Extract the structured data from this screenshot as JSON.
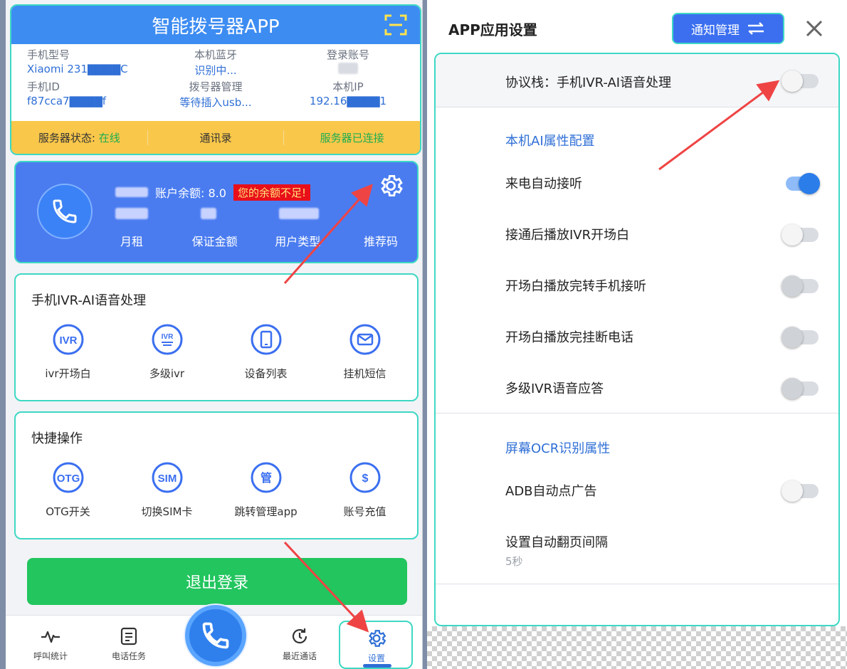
{
  "header": {
    "title": "智能拨号器APP",
    "info": [
      {
        "label": "手机型号",
        "value": "Xiaomi 231▇▇▇▇C"
      },
      {
        "label": "本机蓝牙",
        "value": "识别中..."
      },
      {
        "label": "登录账号",
        "value": ""
      },
      {
        "label": "手机ID",
        "value": "f87cca7▇▇▇▇f"
      },
      {
        "label": "拨号器管理",
        "value": "等待插入usb..."
      },
      {
        "label": "本机IP",
        "value": "192.16▇▇▇▇1"
      }
    ],
    "status": {
      "server_label": "服务器状态:",
      "server_value": "在线",
      "contacts": "通讯录",
      "connected": "服务器已连接"
    }
  },
  "account": {
    "balance": "账户余额: 8.0",
    "warning": "您的余额不足!",
    "labels": [
      "月租",
      "保证金额",
      "用户类型",
      "推荐码"
    ]
  },
  "ivr_card": {
    "title": "手机IVR-AI语音处理",
    "items": [
      {
        "label": "ivr开场白",
        "icon": "ivr-icon"
      },
      {
        "label": "多级ivr",
        "icon": "multi-ivr-icon"
      },
      {
        "label": "设备列表",
        "icon": "device-list-icon"
      },
      {
        "label": "挂机短信",
        "icon": "sms-icon"
      }
    ]
  },
  "quick_card": {
    "title": "快捷操作",
    "items": [
      {
        "label": "OTG开关",
        "icon": "otg-icon"
      },
      {
        "label": "切换SIM卡",
        "icon": "sim-icon"
      },
      {
        "label": "跳转管理app",
        "icon": "manage-icon"
      },
      {
        "label": "账号充值",
        "icon": "dollar-icon"
      }
    ]
  },
  "logout_label": "退出登录",
  "nav": {
    "items": [
      "呼叫统计",
      "电话任务",
      "最近通话",
      "设置"
    ]
  },
  "settings": {
    "title": "APP应用设置",
    "notify_button": "通知管理",
    "protocol_stack": "协议栈：手机IVR-AI语音处理",
    "section_ai": "本机AI属性配置",
    "auto_answer": "来电自动接听",
    "play_ivr": "接通后播放IVR开场白",
    "transfer_phone": "开场白播放完转手机接听",
    "hangup_after": "开场白播放完挂断电话",
    "multi_ivr": "多级IVR语音应答",
    "section_ocr": "屏幕OCR识别属性",
    "adb_ads": "ADB自动点广告",
    "page_interval_label": "设置自动翻页间隔",
    "page_interval_value": "5秒",
    "toggles": {
      "protocol_stack": false,
      "auto_answer": true,
      "play_ivr": false,
      "transfer_phone": false,
      "hangup_after": false,
      "multi_ivr": false,
      "adb_ads": false
    }
  },
  "colors": {
    "primary_blue": "#3d8cf2",
    "accent_teal": "#3ed8c4",
    "status_yellow": "#f9c74a",
    "success_green": "#22c55e",
    "warning_red": "#e80f1a",
    "annotation_arrow": "#ef4444"
  }
}
